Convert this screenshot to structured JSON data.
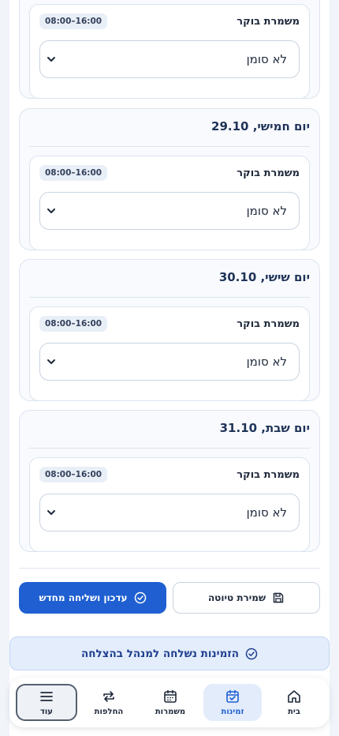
{
  "days": [
    {
      "title": "",
      "shift": {
        "name": "משמרת בוקר",
        "hours": "08:00–16:00",
        "selected": "לא סומן"
      }
    },
    {
      "title": "יום חמישי, 29.10",
      "shift": {
        "name": "משמרת בוקר",
        "hours": "08:00–16:00",
        "selected": "לא סומן"
      }
    },
    {
      "title": "יום שישי, 30.10",
      "shift": {
        "name": "משמרת בוקר",
        "hours": "08:00–16:00",
        "selected": "לא סומן"
      }
    },
    {
      "title": "יום שבת, 31.10",
      "shift": {
        "name": "משמרת בוקר",
        "hours": "08:00–16:00",
        "selected": "לא סומן"
      }
    }
  ],
  "actions": {
    "save_draft_label": "שמירת טיוטה",
    "update_resend_label": "עדכון ושליחה מחדש"
  },
  "toast": {
    "message": "הזמינות נשלחה למנהל בהצלחה"
  },
  "nav": {
    "home": "בית",
    "availability": "זמינות",
    "shifts": "משמרות",
    "swaps": "החלפות",
    "more": "עוד"
  },
  "colors": {
    "primary": "#1f5fd1",
    "toast_bg": "#e4edfc",
    "active_nav_bg": "#e3ecfb"
  }
}
